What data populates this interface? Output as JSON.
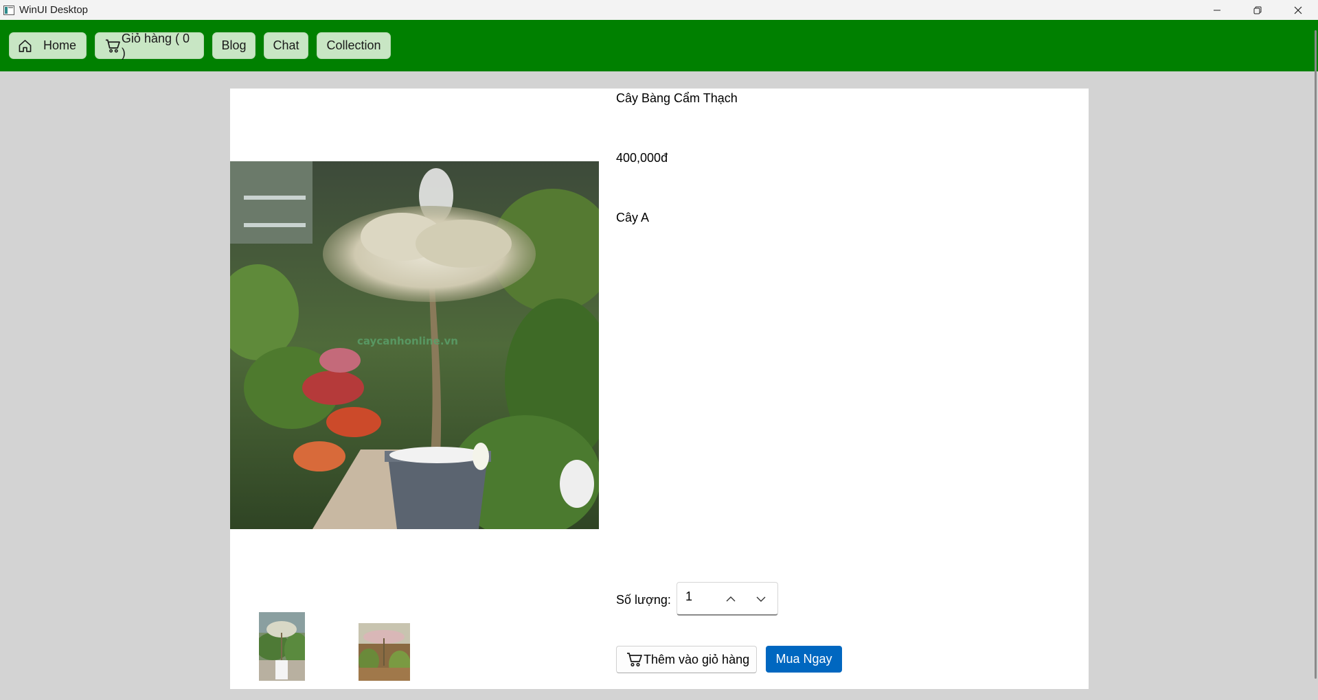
{
  "window": {
    "title": "WinUI Desktop"
  },
  "nav": {
    "home_label": "Home",
    "cart_label": "Giỏ hàng ( 0 )",
    "blog_label": "Blog",
    "chat_label": "Chat",
    "collection_label": "Collection"
  },
  "product": {
    "name": "Cây Bàng Cẩm Thạch",
    "price": "400,000đ",
    "description": "Cây A",
    "watermark": "caycanhonline.vn"
  },
  "quantity": {
    "label": "Số lượng:",
    "value": "1"
  },
  "actions": {
    "add_to_cart_label": "Thêm vào giỏ hàng",
    "buy_now_label": "Mua Ngay"
  },
  "colors": {
    "navbar": "#008000",
    "nav_button": "#c8e6c4",
    "buy_button": "#0067c0",
    "background": "#d3d3d3"
  },
  "icons": {
    "home": "home-icon",
    "cart": "cart-icon",
    "minimize": "minimize-icon",
    "restore": "restore-icon",
    "close": "close-icon",
    "up": "chevron-up-icon",
    "down": "chevron-down-icon"
  }
}
